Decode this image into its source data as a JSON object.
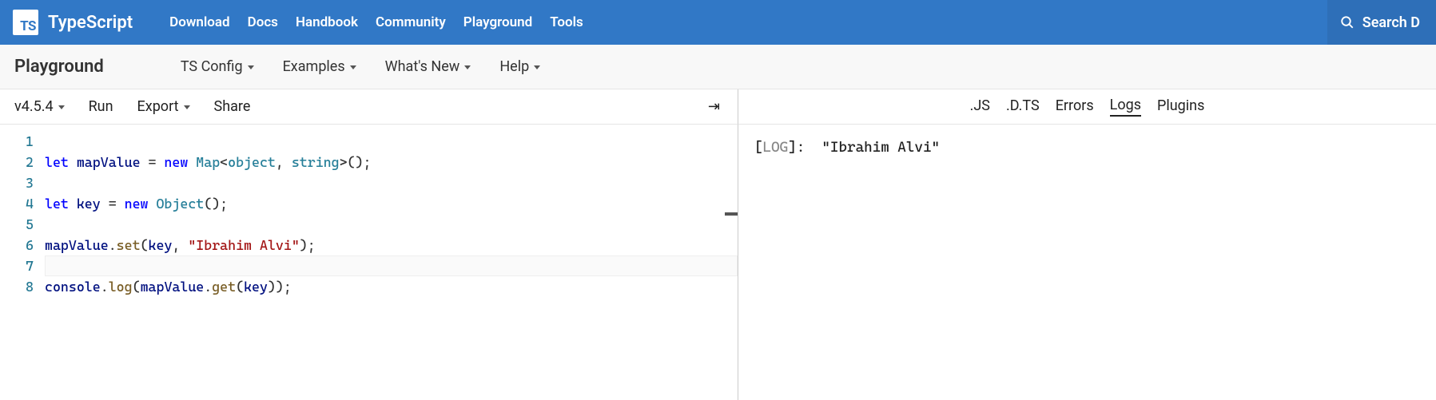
{
  "header": {
    "brand": "TypeScript",
    "logo_short": "TS",
    "nav": [
      "Download",
      "Docs",
      "Handbook",
      "Community",
      "Playground",
      "Tools"
    ],
    "search_label": "Search D"
  },
  "subnav": {
    "title": "Playground",
    "items": [
      "TS Config",
      "Examples",
      "What's New",
      "Help"
    ]
  },
  "toolbar": {
    "version": "v4.5.4",
    "run": "Run",
    "export": "Export",
    "share": "Share",
    "run_symbol": "⇥"
  },
  "output_tabs": {
    "tabs": [
      ".JS",
      ".D.TS",
      "Errors",
      "Logs",
      "Plugins"
    ],
    "active": "Logs"
  },
  "editor": {
    "line_numbers": [
      "1",
      "2",
      "3",
      "4",
      "5",
      "6",
      "7",
      "8"
    ],
    "current_line_index": 6,
    "code_tokens": [
      [],
      [
        {
          "t": "kw",
          "v": "let "
        },
        {
          "t": "vr",
          "v": "mapValue"
        },
        {
          "t": "pn",
          "v": " = "
        },
        {
          "t": "kw",
          "v": "new "
        },
        {
          "t": "tp",
          "v": "Map"
        },
        {
          "t": "pn",
          "v": "<"
        },
        {
          "t": "tp",
          "v": "object"
        },
        {
          "t": "pn",
          "v": ", "
        },
        {
          "t": "tp",
          "v": "string"
        },
        {
          "t": "pn",
          "v": ">();"
        }
      ],
      [],
      [
        {
          "t": "kw",
          "v": "let "
        },
        {
          "t": "vr",
          "v": "key"
        },
        {
          "t": "pn",
          "v": " = "
        },
        {
          "t": "kw",
          "v": "new "
        },
        {
          "t": "tp",
          "v": "Object"
        },
        {
          "t": "pn",
          "v": "();"
        }
      ],
      [],
      [
        {
          "t": "vr",
          "v": "mapValue"
        },
        {
          "t": "pn",
          "v": "."
        },
        {
          "t": "mt",
          "v": "set"
        },
        {
          "t": "pn",
          "v": "("
        },
        {
          "t": "vr",
          "v": "key"
        },
        {
          "t": "pn",
          "v": ", "
        },
        {
          "t": "st",
          "v": "\"Ibrahim Alvi\""
        },
        {
          "t": "pn",
          "v": ");"
        }
      ],
      [],
      [
        {
          "t": "vr",
          "v": "console"
        },
        {
          "t": "pn",
          "v": "."
        },
        {
          "t": "mt",
          "v": "log"
        },
        {
          "t": "pn",
          "v": "("
        },
        {
          "t": "vr",
          "v": "mapValue"
        },
        {
          "t": "pn",
          "v": "."
        },
        {
          "t": "mt",
          "v": "get"
        },
        {
          "t": "pn",
          "v": "("
        },
        {
          "t": "vr",
          "v": "key"
        },
        {
          "t": "pn",
          "v": "));"
        }
      ]
    ]
  },
  "output": {
    "prefix_open": "[",
    "prefix_tag": "LOG",
    "prefix_close": "]: ",
    "value": "\"Ibrahim Alvi\""
  }
}
